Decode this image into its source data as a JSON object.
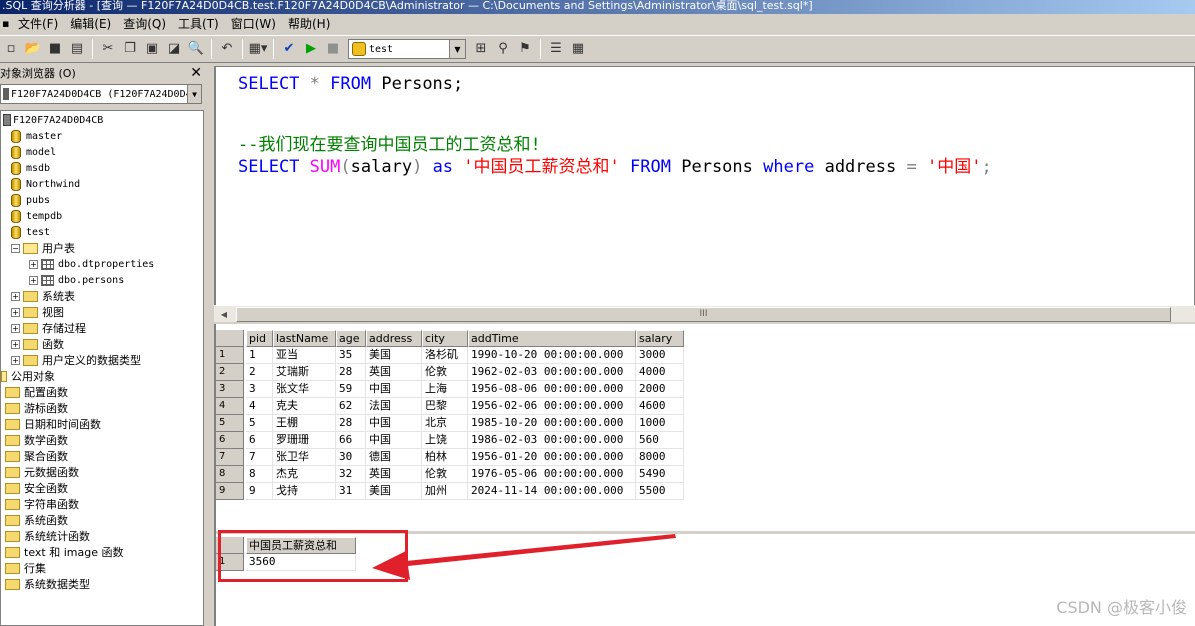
{
  "window": {
    "title": ".SQL 查询分析器 - [查询 — F120F7A24D0D4CB.test.F120F7A24D0D4CB\\Administrator — C:\\Documents and Settings\\Administrator\\桌面\\sql_test.sql*]"
  },
  "menu": {
    "items": [
      "文件(F)",
      "编辑(E)",
      "查询(Q)",
      "工具(T)",
      "窗口(W)",
      "帮助(H)"
    ]
  },
  "toolbar": {
    "database": "test",
    "icons": [
      "new-query-icon",
      "open-icon",
      "save-icon",
      "load-script-icon",
      "cut-icon",
      "copy-icon",
      "paste-icon",
      "clear-icon",
      "find-icon",
      "undo-icon",
      "results-mode-icon",
      "parse-icon",
      "execute-icon",
      "stop-icon",
      "object-browser-icon",
      "object-search-icon",
      "estimated-plan-icon",
      "properties-icon",
      "grid-icon"
    ]
  },
  "browser": {
    "title": "对象浏览器 (O)",
    "close": "✕",
    "server_select": "F120F7A24D0D4CB (F120F7A24D0D4",
    "tree": {
      "server": "F120F7A24D0D4CB",
      "databases": [
        "master",
        "model",
        "msdb",
        "Northwind",
        "pubs",
        "tempdb",
        "test"
      ],
      "test_children": {
        "user_tables": "用户表",
        "tables": [
          "dbo.dtproperties",
          "dbo.persons"
        ],
        "folders": [
          "系统表",
          "视图",
          "存储过程",
          "函数",
          "用户定义的数据类型"
        ]
      },
      "common_objects": "公用对象",
      "common_children": [
        "配置函数",
        "游标函数",
        "日期和时间函数",
        "数学函数",
        "聚合函数",
        "元数据函数",
        "安全函数",
        "字符串函数",
        "系统函数",
        "系统统计函数",
        "text 和 image 函数",
        "行集",
        "系统数据类型"
      ]
    }
  },
  "editor": {
    "line1": {
      "kw1": "SELECT",
      "star": "*",
      "kw2": "FROM",
      "tbl": "Persons;"
    },
    "comment": "--我们现在要查询中国员工的工资总和!",
    "line3": {
      "kw1": "SELECT",
      "fn": "SUM",
      "p1": "(",
      "arg": "salary",
      "p2": ")",
      "kw2": "as",
      "alias": "'中国员工薪资总和'",
      "kw3": "FROM",
      "tbl": "Persons",
      "kw4": "where",
      "col": "address",
      "eq": "=",
      "val": "'中国'",
      "end": ";"
    },
    "scroll_grip": "III"
  },
  "results": {
    "columns": [
      "pid",
      "lastName",
      "age",
      "address",
      "city",
      "addTime",
      "salary"
    ],
    "rows": [
      [
        "1",
        "亚当",
        "35",
        "美国",
        "洛杉矶",
        "1990-10-20 00:00:00.000",
        "3000"
      ],
      [
        "2",
        "艾瑞斯",
        "28",
        "英国",
        "伦敦",
        "1962-02-03 00:00:00.000",
        "4000"
      ],
      [
        "3",
        "张文华",
        "59",
        "中国",
        "上海",
        "1956-08-06 00:00:00.000",
        "2000"
      ],
      [
        "4",
        "克夫",
        "62",
        "法国",
        "巴黎",
        "1956-02-06 00:00:00.000",
        "4600"
      ],
      [
        "5",
        "王棚",
        "28",
        "中国",
        "北京",
        "1985-10-20 00:00:00.000",
        "1000"
      ],
      [
        "6",
        "罗珊珊",
        "66",
        "中国",
        "上饶",
        "1986-02-03 00:00:00.000",
        "560"
      ],
      [
        "7",
        "张卫华",
        "30",
        "德国",
        "柏林",
        "1956-01-20 00:00:00.000",
        "8000"
      ],
      [
        "8",
        "杰克",
        "32",
        "英国",
        "伦敦",
        "1976-05-06 00:00:00.000",
        "5490"
      ],
      [
        "9",
        "戈持",
        "31",
        "美国",
        "加州",
        "2024-11-14 00:00:00.000",
        "5500"
      ]
    ],
    "row_numbers": [
      "1",
      "2",
      "3",
      "4",
      "5",
      "6",
      "7",
      "8",
      "9"
    ],
    "sum_column": "中国员工薪资总和",
    "sum_row_number": "1",
    "sum_value": "3560"
  },
  "annotation": {
    "color": "#e0202a"
  },
  "watermark": "CSDN @极客小俊"
}
